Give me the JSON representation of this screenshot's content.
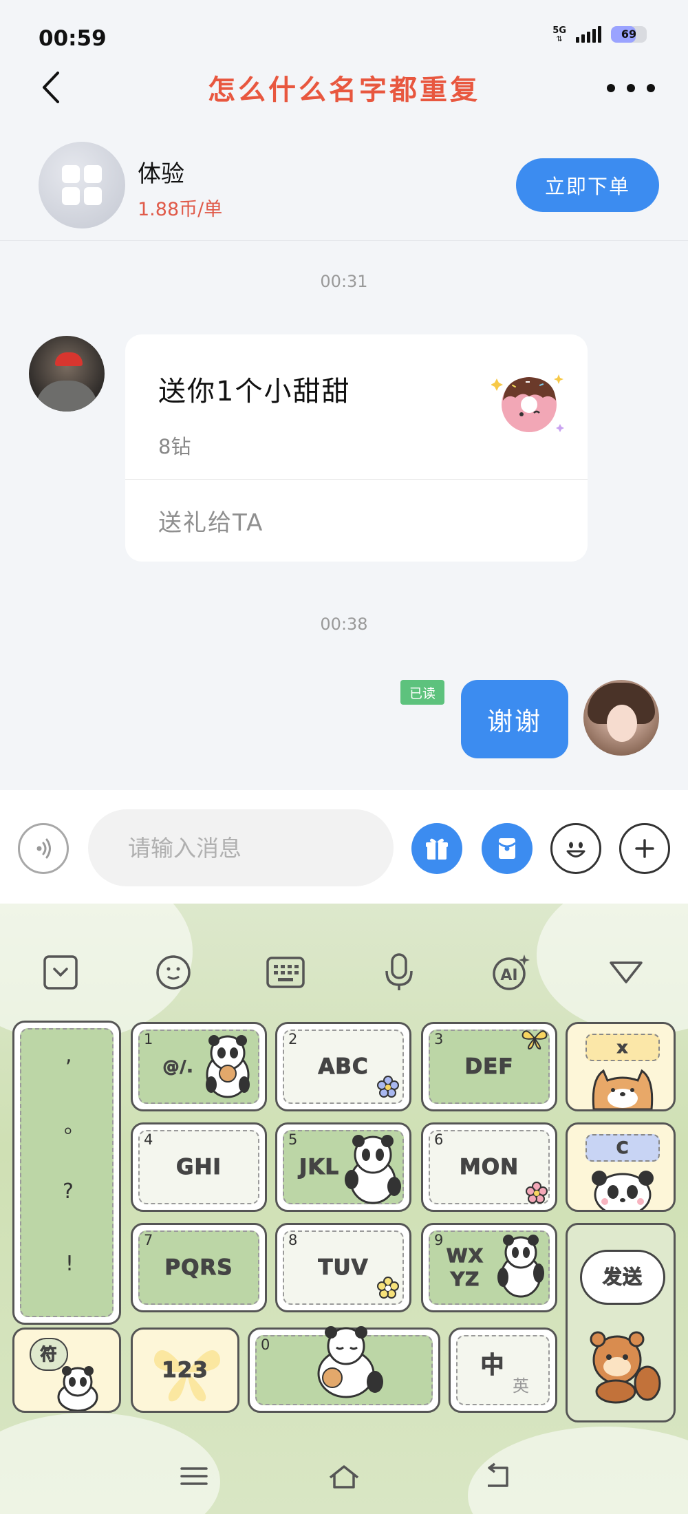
{
  "status_bar": {
    "time": "00:59",
    "network": "5G",
    "battery": "69",
    "battery_level": 0.69
  },
  "header": {
    "title": "怎么什么名字都重复"
  },
  "order": {
    "service_name": "体验",
    "price": "1.88币/单",
    "order_button": "立即下单"
  },
  "chat": {
    "timestamp_1": "00:31",
    "gift_message": {
      "title": "送你1个小甜甜",
      "cost": "8钻",
      "action": "送礼给TA"
    },
    "timestamp_2": "00:38",
    "my_message": {
      "read_status": "已读",
      "text": "谢谢"
    }
  },
  "input": {
    "placeholder": "请输入消息"
  },
  "keyboard": {
    "keys": {
      "k1": {
        "num": "1",
        "label": "@/."
      },
      "k2": {
        "num": "2",
        "label": "ABC"
      },
      "k3": {
        "num": "3",
        "label": "DEF"
      },
      "k4": {
        "num": "4",
        "label": "GHI"
      },
      "k5": {
        "num": "5",
        "label": "JKL"
      },
      "k6": {
        "num": "6",
        "label": "MON"
      },
      "k7": {
        "num": "7",
        "label": "PQRS"
      },
      "k8": {
        "num": "8",
        "label": "TUV"
      },
      "k9": {
        "num": "9",
        "label": "WX\nYZ"
      },
      "k0": {
        "num": "0"
      },
      "delete": "x",
      "reenter": "C",
      "send": "发送",
      "symbols": "符",
      "numbers": "123",
      "lang_zh": "中",
      "lang_en": "英"
    },
    "punctuation": [
      ",",
      "。",
      "?",
      "!"
    ]
  }
}
